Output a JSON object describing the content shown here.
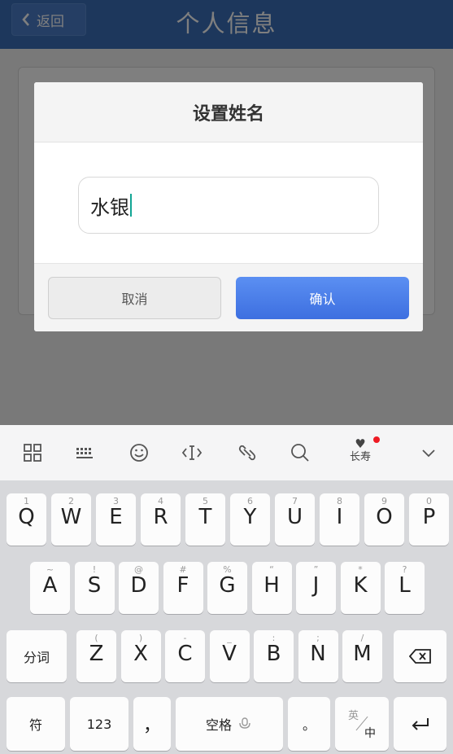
{
  "nav": {
    "back_label": "返回",
    "title": "个人信息"
  },
  "dialog": {
    "title": "设置姓名",
    "input_value": "水银",
    "cancel_label": "取消",
    "confirm_label": "确认"
  },
  "keyboard": {
    "toolbar": [
      {
        "name": "grid-icon"
      },
      {
        "name": "keyboard-icon"
      },
      {
        "name": "emoji-icon"
      },
      {
        "name": "cursor-icon"
      },
      {
        "name": "link-icon"
      },
      {
        "name": "search-icon"
      },
      {
        "name": "changshou-icon",
        "label": "长寿"
      },
      {
        "name": "collapse-icon"
      }
    ],
    "row1": [
      {
        "k": "Q",
        "h": "1"
      },
      {
        "k": "W",
        "h": "2"
      },
      {
        "k": "E",
        "h": "3"
      },
      {
        "k": "R",
        "h": "4"
      },
      {
        "k": "T",
        "h": "5"
      },
      {
        "k": "Y",
        "h": "6"
      },
      {
        "k": "U",
        "h": "7"
      },
      {
        "k": "I",
        "h": "8"
      },
      {
        "k": "O",
        "h": "9"
      },
      {
        "k": "P",
        "h": "0"
      }
    ],
    "row2": [
      {
        "k": "A",
        "h": "~"
      },
      {
        "k": "S",
        "h": "!"
      },
      {
        "k": "D",
        "h": "@"
      },
      {
        "k": "F",
        "h": "#"
      },
      {
        "k": "G",
        "h": "%"
      },
      {
        "k": "H",
        "h": "“"
      },
      {
        "k": "J",
        "h": "”"
      },
      {
        "k": "K",
        "h": "*"
      },
      {
        "k": "L",
        "h": "?"
      }
    ],
    "row3": [
      {
        "k": "Z",
        "h": "("
      },
      {
        "k": "X",
        "h": ")"
      },
      {
        "k": "C",
        "h": "-"
      },
      {
        "k": "V",
        "h": "_"
      },
      {
        "k": "B",
        "h": ":"
      },
      {
        "k": "N",
        "h": ";"
      },
      {
        "k": "M",
        "h": "/"
      }
    ],
    "fenci_label": "分词",
    "fu_label": "符",
    "num_label": "123",
    "comma_label": "，",
    "space_label": "空格",
    "period_label": "。",
    "lang_en": "英",
    "lang_zh": "中"
  },
  "colors": {
    "nav": "#3a6fb8",
    "confirm": "#4a7ceb",
    "caret": "#12a594"
  }
}
